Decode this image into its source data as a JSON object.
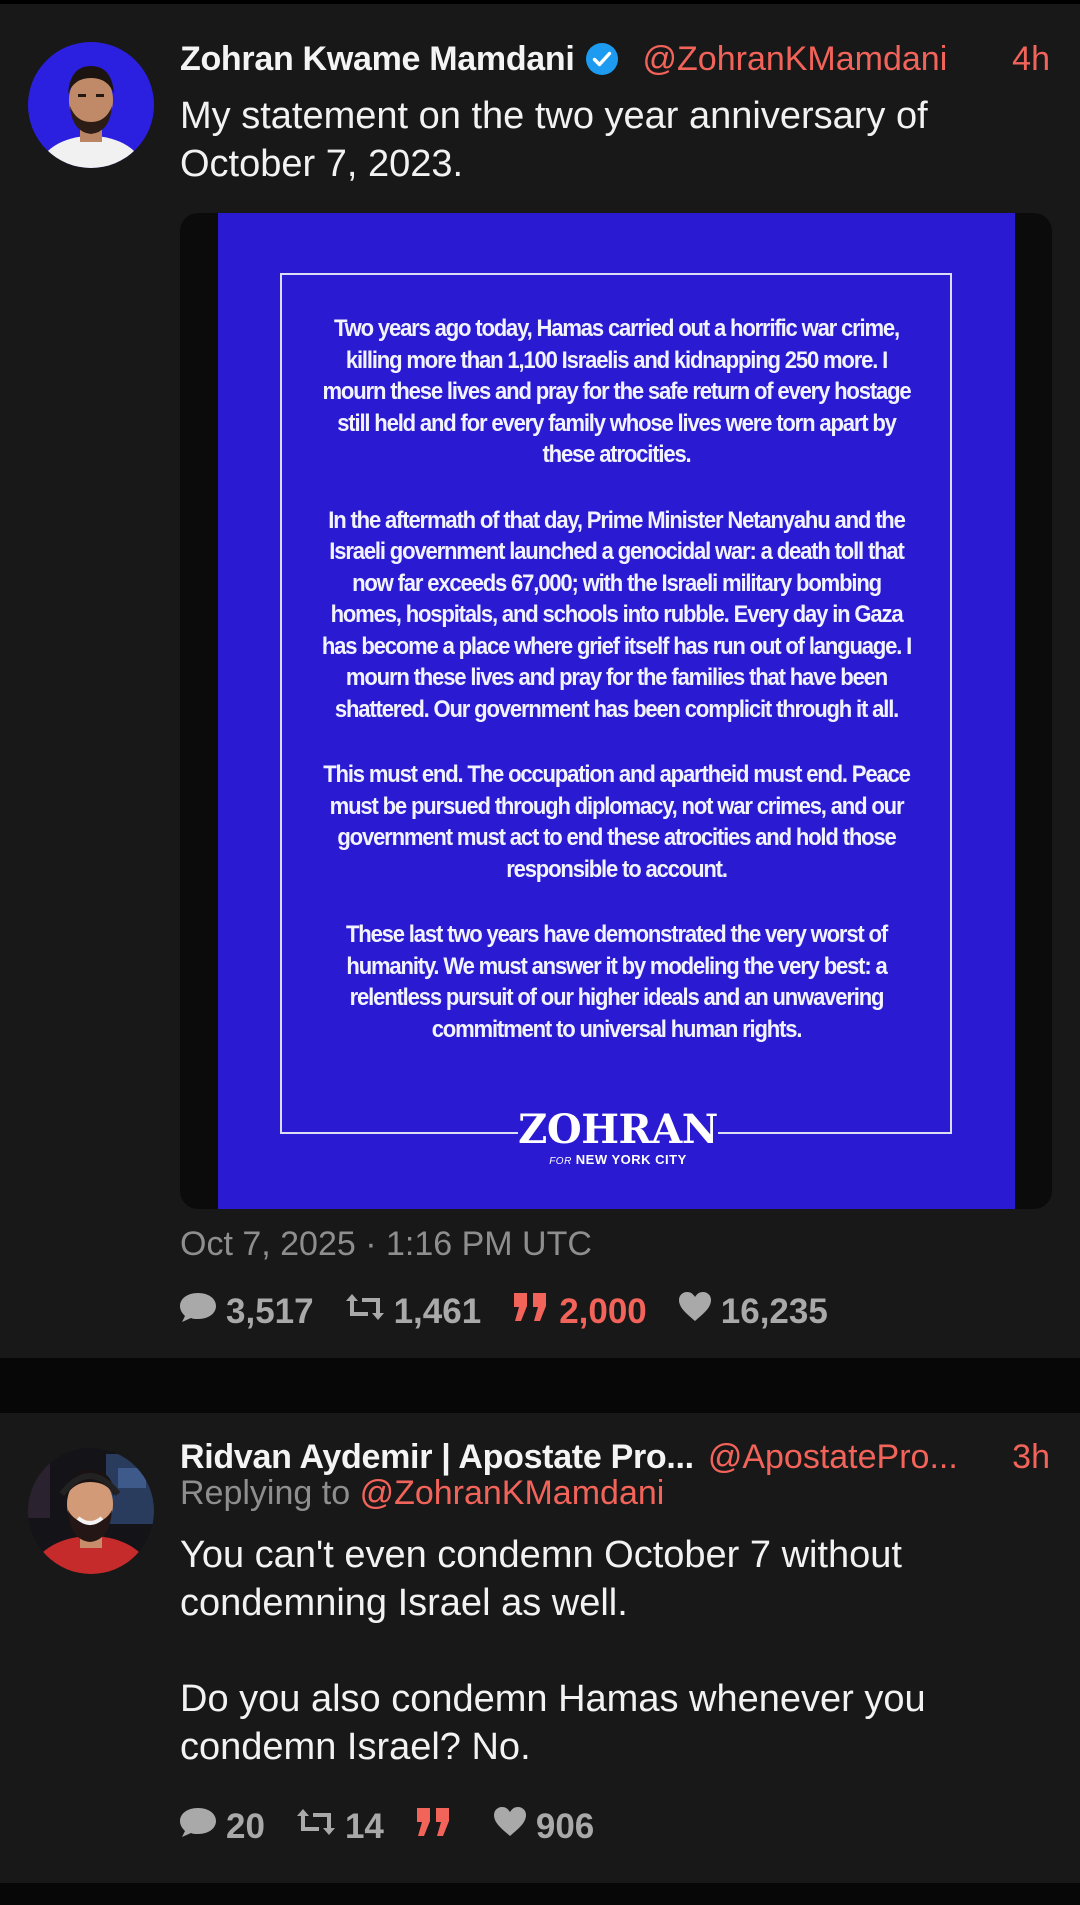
{
  "tweets": [
    {
      "author_name": "Zohran Kwame Mamdani",
      "handle": "@ZohranKMamdani",
      "time_ago": "4h",
      "text": "My statement on the two year anniversary of October 7, 2023.",
      "image_statement": {
        "paragraphs": [
          "Two years ago today, Hamas carried out a horrific war crime, killing more than 1,100 Israelis and kidnapping 250 more. I mourn these lives and pray for the safe return of every hostage still held and for every family whose lives were torn apart by these atrocities.",
          "In the aftermath of that day, Prime Minister Netanyahu and the Israeli government launched a genocidal war: a death toll that now far exceeds 67,000; with the Israeli military bombing homes, hospitals, and schools into rubble. Every day in Gaza has become a place where grief itself has run out of language. I mourn these lives and pray for the families that have been shattered. Our government has been complicit through it all.",
          "This must end. The occupation and apartheid must end. Peace must be pursued through diplomacy, not war crimes, and our government must act to end these atrocities and hold those responsible to account.",
          "These last two years have demonstrated the very worst of humanity. We must answer it by modeling the very best: a relentless pursuit of our higher ideals and an unwavering commitment to universal human rights."
        ],
        "logo_text": "ZOHRAN",
        "logo_for": "FOR",
        "logo_sub": "NEW YORK CITY",
        "background_color": "#2a1bd3"
      },
      "timestamp": "Oct 7, 2025 · 1:16 PM UTC",
      "stats": {
        "replies": "3,517",
        "retweets": "1,461",
        "quotes": "2,000",
        "likes": "16,235"
      }
    },
    {
      "author_name": "Ridvan Aydemir | Apostate Pro...",
      "handle": "@ApostatePro...",
      "time_ago": "3h",
      "replying_to_label": "Replying to",
      "replying_to_handle": "@ZohranKMamdani",
      "text": "You can't even condemn October 7 without condemning Israel as well.\n\nDo you also condemn Hamas whenever you condemn Israel? No.",
      "stats": {
        "replies": "20",
        "retweets": "14",
        "quotes": "",
        "likes": "906"
      }
    }
  ],
  "colors": {
    "accent": "#f2635a",
    "verified": "#1d9bf0",
    "background": "#181818",
    "muted": "#8e8e8e"
  }
}
